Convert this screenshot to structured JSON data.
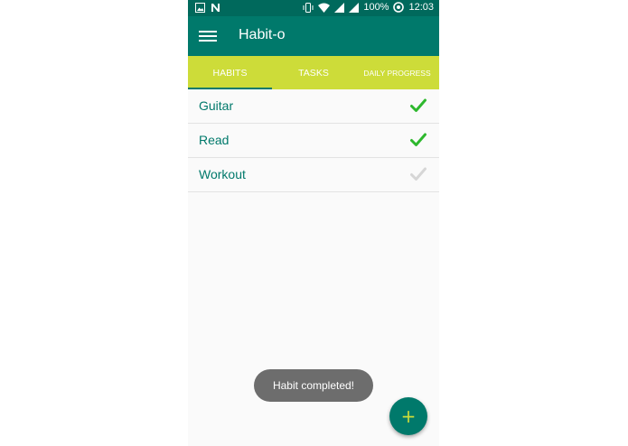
{
  "status_bar": {
    "battery": "100%",
    "time": "12:03",
    "icons_left": [
      "image-icon",
      "n-notification-icon"
    ],
    "icons_right": [
      "vibrate-icon",
      "wifi-icon",
      "signal-icon",
      "signal-icon",
      "data-saver-icon"
    ]
  },
  "app_bar": {
    "title": "Habit-o",
    "menu_icon": "hamburger-menu-icon"
  },
  "tabs": [
    {
      "label": "HABITS",
      "active": true
    },
    {
      "label": "TASKS",
      "active": false
    },
    {
      "label": "DAILY PROGRESS",
      "active": false
    }
  ],
  "habits": [
    {
      "name": "Guitar",
      "completed": true
    },
    {
      "name": "Read",
      "completed": true
    },
    {
      "name": "Workout",
      "completed": false
    }
  ],
  "toast": {
    "message": "Habit completed!"
  },
  "fab": {
    "icon": "plus-icon"
  },
  "colors": {
    "primary": "#00796b",
    "primary_dark": "#00695c",
    "accent": "#cddc39",
    "check_done": "#2eb82e",
    "check_pending": "#d6d6d6"
  }
}
